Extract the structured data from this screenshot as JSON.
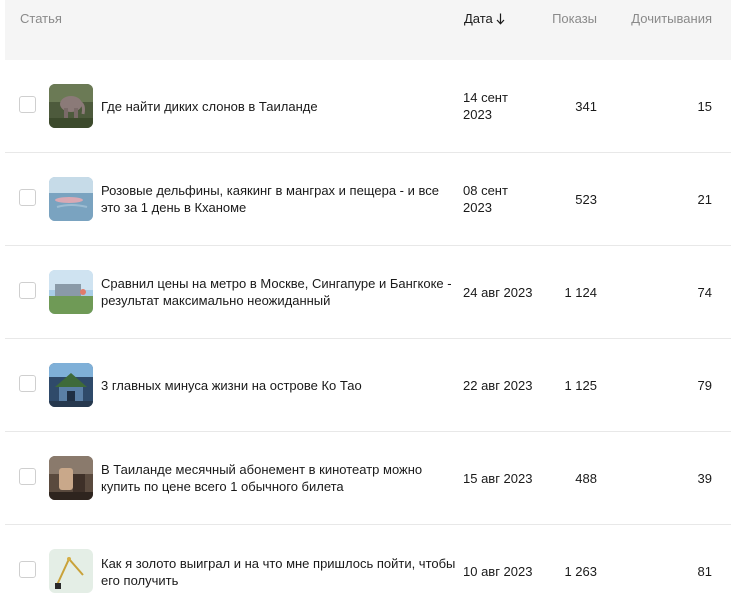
{
  "header": {
    "article": "Статья",
    "date": "Дата",
    "views": "Показы",
    "reads": "Дочитывания"
  },
  "rows": [
    {
      "title": "Где найти диких слонов в Таиланде",
      "date": "14 сент 2023",
      "views": "341",
      "reads": "15"
    },
    {
      "title": "Розовые дельфины, каякинг в манграх и пещера - и все это за 1 день в Кханоме",
      "date": "08 сент 2023",
      "views": "523",
      "reads": "21"
    },
    {
      "title": "Сравнил цены на метро в Москве, Сингапуре и Бангкоке - результат максимально неожиданный",
      "date": "24 авг 2023",
      "views": "1 124",
      "reads": "74"
    },
    {
      "title": "3 главных минуса жизни на острове Ко Тао",
      "date": "22 авг 2023",
      "views": "1 125",
      "reads": "79"
    },
    {
      "title": "В Таиланде месячный абонемент в кинотеатр можно купить по цене всего 1 обычного билета",
      "date": "15 авг 2023",
      "views": "488",
      "reads": "39"
    },
    {
      "title": "Как я золото выиграл и на что мне пришлось пойти, чтобы его получить",
      "date": "10 авг 2023",
      "views": "1 263",
      "reads": "81"
    }
  ]
}
